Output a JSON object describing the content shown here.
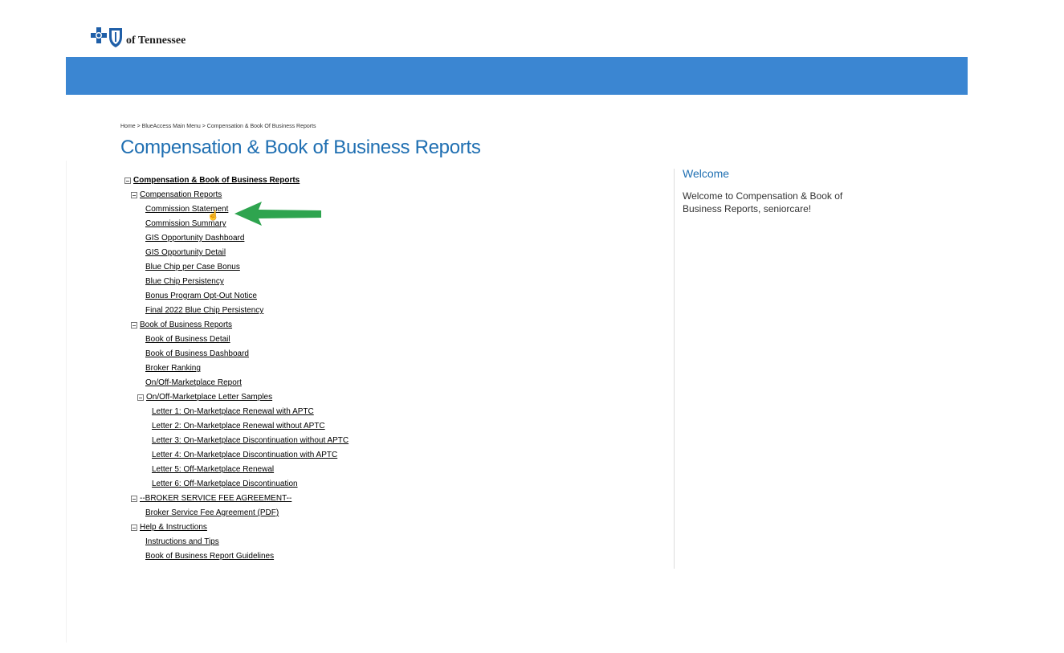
{
  "header": {
    "logo_text": "of Tennessee"
  },
  "breadcrumb": "Home > BlueAccess Main Menu > Compensation & Book Of Business Reports",
  "page_title": "Compensation & Book of Business Reports",
  "tree": {
    "root": "Compensation & Book of Business Reports",
    "compensation_reports": {
      "label": "Compensation Reports",
      "items": [
        "Commission Statement",
        "Commission Summary",
        "GIS Opportunity Dashboard",
        "GIS Opportunity Detail",
        "Blue Chip per Case Bonus",
        "Blue Chip Persistency",
        "Bonus Program Opt-Out Notice",
        "Final 2022 Blue Chip Persistency"
      ]
    },
    "book_of_business_reports": {
      "label": "Book of Business Reports",
      "items": [
        "Book of Business Detail",
        "Book of Business Dashboard",
        "Broker Ranking",
        "On/Off-Marketplace Report"
      ],
      "letter_samples": {
        "label": "On/Off-Marketplace Letter Samples",
        "items": [
          "Letter 1: On-Marketplace Renewal with APTC",
          "Letter 2: On-Marketplace Renewal without APTC",
          "Letter 3: On-Marketplace Discontinuation without APTC",
          "Letter 4: On-Marketplace Discontinuation with APTC",
          "Letter 5: Off-Marketplace Renewal",
          "Letter 6: Off-Marketplace Discontinuation"
        ]
      }
    },
    "broker_service_fee": {
      "label": "--BROKER SERVICE FEE AGREEMENT--",
      "items": [
        "Broker Service Fee Agreement (PDF)"
      ]
    },
    "help": {
      "label": "Help & Instructions",
      "items": [
        "Instructions and Tips",
        "Book of Business Report Guidelines"
      ]
    }
  },
  "welcome": {
    "title": "Welcome",
    "text": "Welcome to Compensation & Book of Business Reports, seniorcare!"
  },
  "colors": {
    "band": "#3b86d2",
    "title": "#1f6fb2",
    "arrow": "#2ea44f"
  }
}
